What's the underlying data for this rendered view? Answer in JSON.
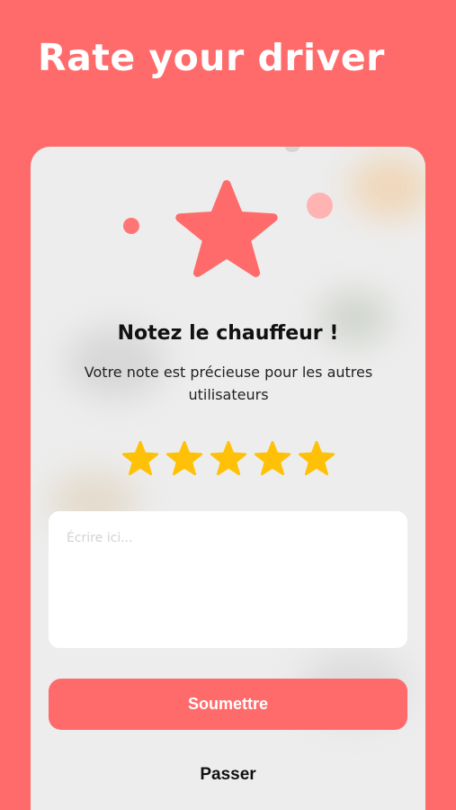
{
  "header": {
    "title": "Rate your driver"
  },
  "card": {
    "heading": "Notez le chauffeur !",
    "subtitle": "Votre note est précieuse pour les autres utilisateurs",
    "rating": {
      "value": 5,
      "max": 5,
      "star_color": "#FFC107"
    },
    "comment": {
      "value": "",
      "placeholder": "Écrire ici..."
    },
    "submit_label": "Soumettre",
    "skip_label": "Passer"
  },
  "colors": {
    "brand": "#FF6B6B",
    "card_background": "#EDEDED",
    "decorative_star": "#FF6B6B"
  }
}
